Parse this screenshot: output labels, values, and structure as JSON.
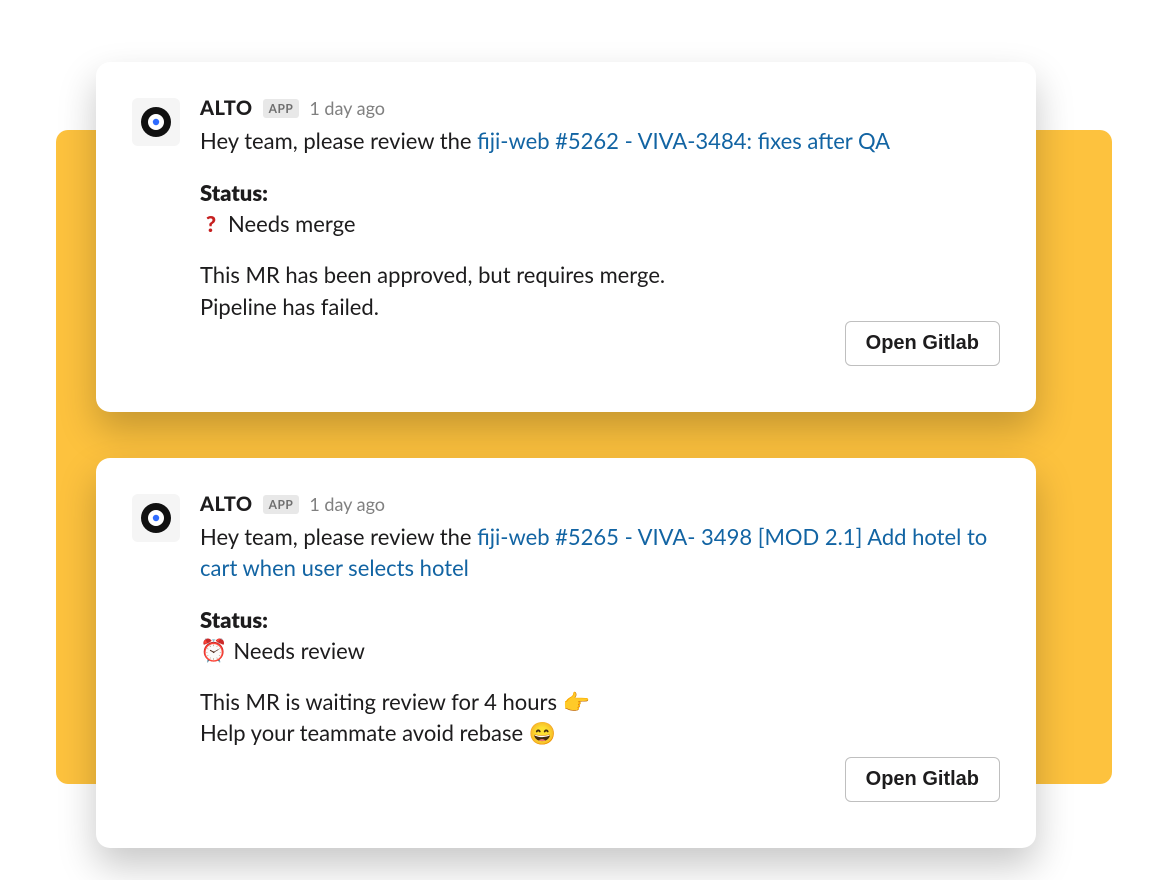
{
  "colors": {
    "bg_accent": "#fdc23e",
    "link": "#1264a3"
  },
  "button_label": "Open Gitlab",
  "messages": [
    {
      "app_name": "ALTO",
      "app_badge": "APP",
      "timestamp": "1 day ago",
      "intro_text": "Hey team, please review the ",
      "link_text": "fiji-web #5262 - VIVA-3484: fixes after QA",
      "status_label": "Status:",
      "status_icon": "question",
      "status_text": "Needs merge",
      "detail_line1": "This MR has been approved, but requires merge.",
      "detail_line2": "Pipeline has failed."
    },
    {
      "app_name": "ALTO",
      "app_badge": "APP",
      "timestamp": "1 day ago",
      "intro_text": "Hey team, please review the ",
      "link_text": "fiji-web #5265 - VIVA- 3498 [MOD 2.1] Add hotel to cart when user selects hotel",
      "status_label": "Status:",
      "status_icon": "alarm",
      "status_text": "Needs review",
      "detail_line1": "This MR is waiting review for 4 hours ",
      "detail_emoji1": "👉",
      "detail_line2": "Help your teammate avoid rebase ",
      "detail_emoji2": "😄"
    }
  ]
}
